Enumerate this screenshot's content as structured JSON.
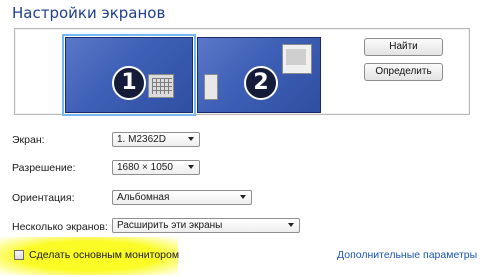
{
  "window": {
    "title": "Настройки экранов"
  },
  "monitors": [
    {
      "label": "1"
    },
    {
      "label": "2"
    }
  ],
  "buttons": {
    "identify_find": "Найти",
    "identify": "Определить"
  },
  "fields": {
    "screen": {
      "label": "Экран:",
      "value": "1. M2362D"
    },
    "resolution": {
      "label": "Разрешение:",
      "value": "1680 × 1050"
    },
    "orientation": {
      "label": "Ориентация:",
      "value": "Альбомная"
    },
    "multiple": {
      "label": "Несколько экранов:",
      "value": "Расширить эти экраны"
    }
  },
  "primary_checkbox": {
    "label": "Сделать основным монитором",
    "checked": false
  },
  "advanced_link": "Дополнительные параметры",
  "colors": {
    "monitor_blue": "#3d5fb5",
    "title_blue": "#1e3f8c",
    "highlight_yellow": "#fbfb25",
    "link_blue": "#1a56b3"
  }
}
